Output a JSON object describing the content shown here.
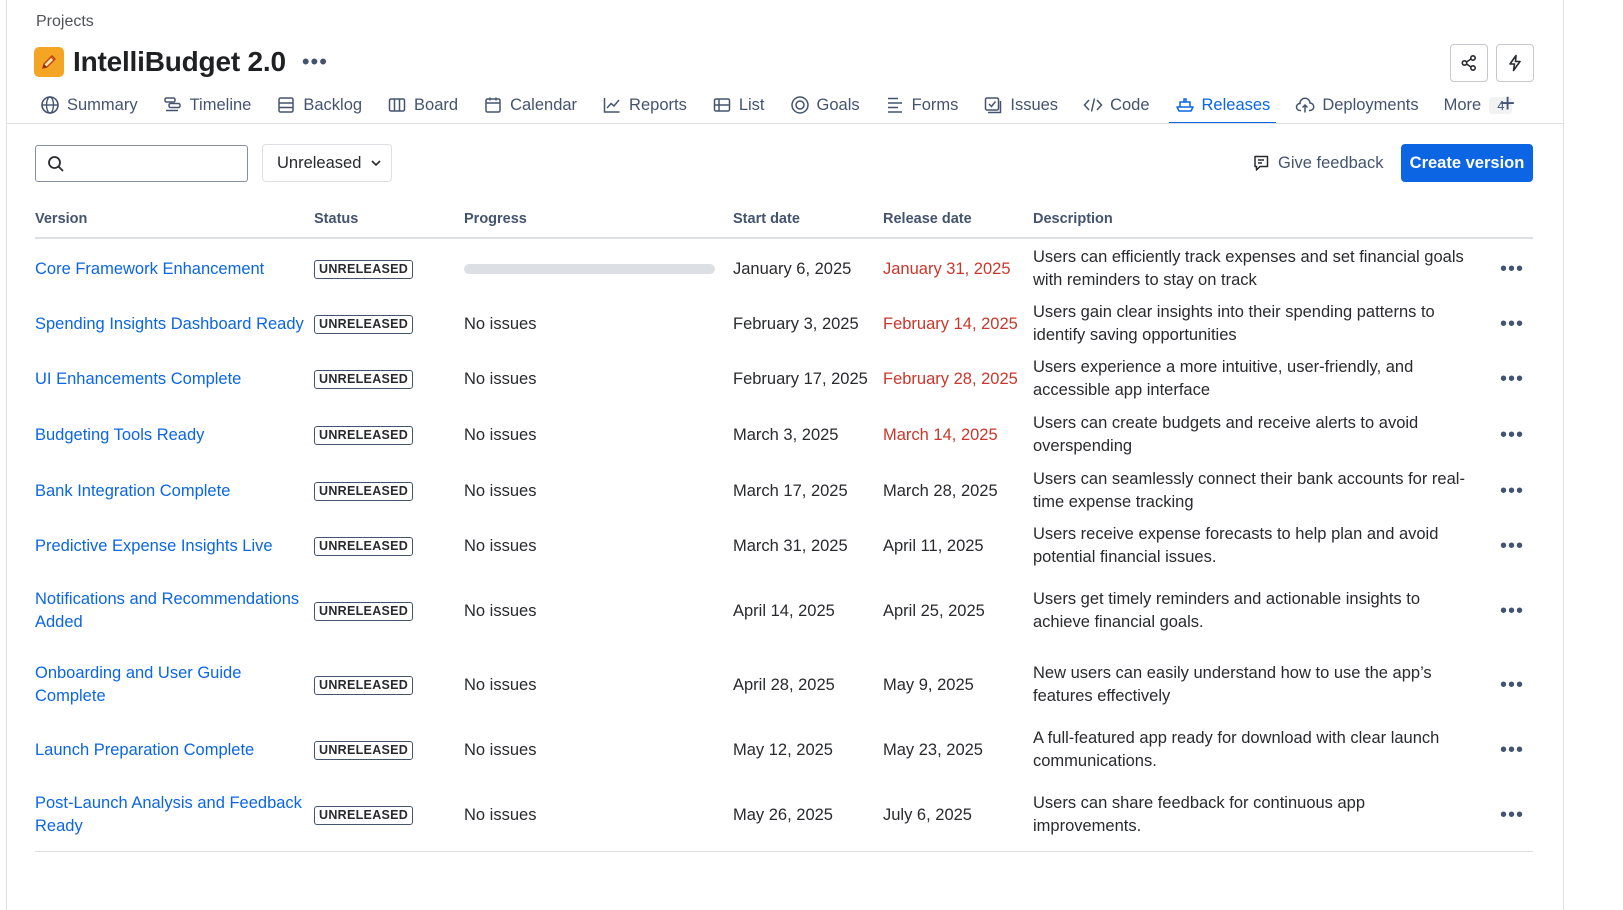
{
  "breadcrumb": "Projects",
  "project": {
    "title": "IntelliBudget 2.0",
    "icon": "pencil-icon",
    "icon_color": "#f5a524"
  },
  "header_actions": [
    {
      "name": "share-button",
      "icon": "share-icon"
    },
    {
      "name": "automation-button",
      "icon": "lightning-icon"
    }
  ],
  "tabs": [
    {
      "label": "Summary",
      "icon": "globe-icon"
    },
    {
      "label": "Timeline",
      "icon": "timeline-icon"
    },
    {
      "label": "Backlog",
      "icon": "backlog-icon"
    },
    {
      "label": "Board",
      "icon": "board-icon"
    },
    {
      "label": "Calendar",
      "icon": "calendar-icon"
    },
    {
      "label": "Reports",
      "icon": "chart-icon"
    },
    {
      "label": "List",
      "icon": "list-icon"
    },
    {
      "label": "Goals",
      "icon": "goal-icon"
    },
    {
      "label": "Forms",
      "icon": "form-icon"
    },
    {
      "label": "Issues",
      "icon": "issues-icon"
    },
    {
      "label": "Code",
      "icon": "code-icon"
    },
    {
      "label": "Releases",
      "icon": "ship-icon",
      "active": true
    },
    {
      "label": "Deployments",
      "icon": "cloud-upload-icon"
    },
    {
      "label": "More",
      "count": "4"
    }
  ],
  "toolbar": {
    "search_placeholder": "",
    "filter_label": "Unreleased",
    "feedback_label": "Give feedback",
    "create_label": "Create version"
  },
  "table": {
    "headers": [
      "Version",
      "Status",
      "Progress",
      "Start date",
      "Release date",
      "Description"
    ],
    "rows": [
      {
        "version": "Core Framework Enhancement",
        "status": "UNRELEASED",
        "progress": "",
        "progress_fraction": 0,
        "start": "January 6, 2025",
        "release": "January 31, 2025",
        "overdue": true,
        "description": "Users can efficiently track expenses and set financial goals with reminders to stay on track"
      },
      {
        "version": "Spending Insights Dashboard Ready",
        "status": "UNRELEASED",
        "progress": "No issues",
        "start": "February 3, 2025",
        "release": "February 14, 2025",
        "overdue": true,
        "description": "Users gain clear insights into their spending patterns to identify saving opportunities"
      },
      {
        "version": "UI Enhancements Complete",
        "status": "UNRELEASED",
        "progress": "No issues",
        "start": "February 17, 2025",
        "release": "February 28, 2025",
        "overdue": true,
        "description": "Users experience a more intuitive, user-friendly, and accessible app interface"
      },
      {
        "version": "Budgeting Tools Ready",
        "status": "UNRELEASED",
        "progress": "No issues",
        "start": "March 3, 2025",
        "release": "March 14, 2025",
        "overdue": true,
        "description": "Users can create budgets and receive alerts to avoid overspending"
      },
      {
        "version": "Bank Integration Complete",
        "status": "UNRELEASED",
        "progress": "No issues",
        "start": "March 17, 2025",
        "release": "March 28, 2025",
        "overdue": false,
        "description": "Users can seamlessly connect their bank accounts for real-time expense tracking"
      },
      {
        "version": "Predictive Expense Insights Live",
        "status": "UNRELEASED",
        "progress": "No issues",
        "start": "March 31, 2025",
        "release": "April 11, 2025",
        "overdue": false,
        "description": "Users receive expense forecasts to help plan and avoid potential financial issues."
      },
      {
        "version": "Notifications and Recommendations Added",
        "status": "UNRELEASED",
        "progress": "No issues",
        "start": "April 14, 2025",
        "release": "April 25, 2025",
        "overdue": false,
        "description": "Users get timely reminders and actionable insights to achieve financial goals."
      },
      {
        "version": "Onboarding and User Guide Complete",
        "status": "UNRELEASED",
        "progress": "No issues",
        "start": "April 28, 2025",
        "release": "May 9, 2025",
        "overdue": false,
        "description": "New users can easily understand how to use the app’s features effectively"
      },
      {
        "version": "Launch Preparation Complete",
        "status": "UNRELEASED",
        "progress": "No issues",
        "start": "May 12, 2025",
        "release": "May 23, 2025",
        "overdue": false,
        "description": "A full-featured app ready for download with clear launch communications."
      },
      {
        "version": "Post-Launch Analysis and Feedback Ready",
        "status": "UNRELEASED",
        "progress": "No issues",
        "start": "May 26, 2025",
        "release": "July 6, 2025",
        "overdue": false,
        "description": "Users can share feedback for continuous app improvements."
      }
    ]
  },
  "colors": {
    "link": "#0c66e4",
    "overdue": "#c9372c",
    "primary_button": "#0c66e4"
  }
}
